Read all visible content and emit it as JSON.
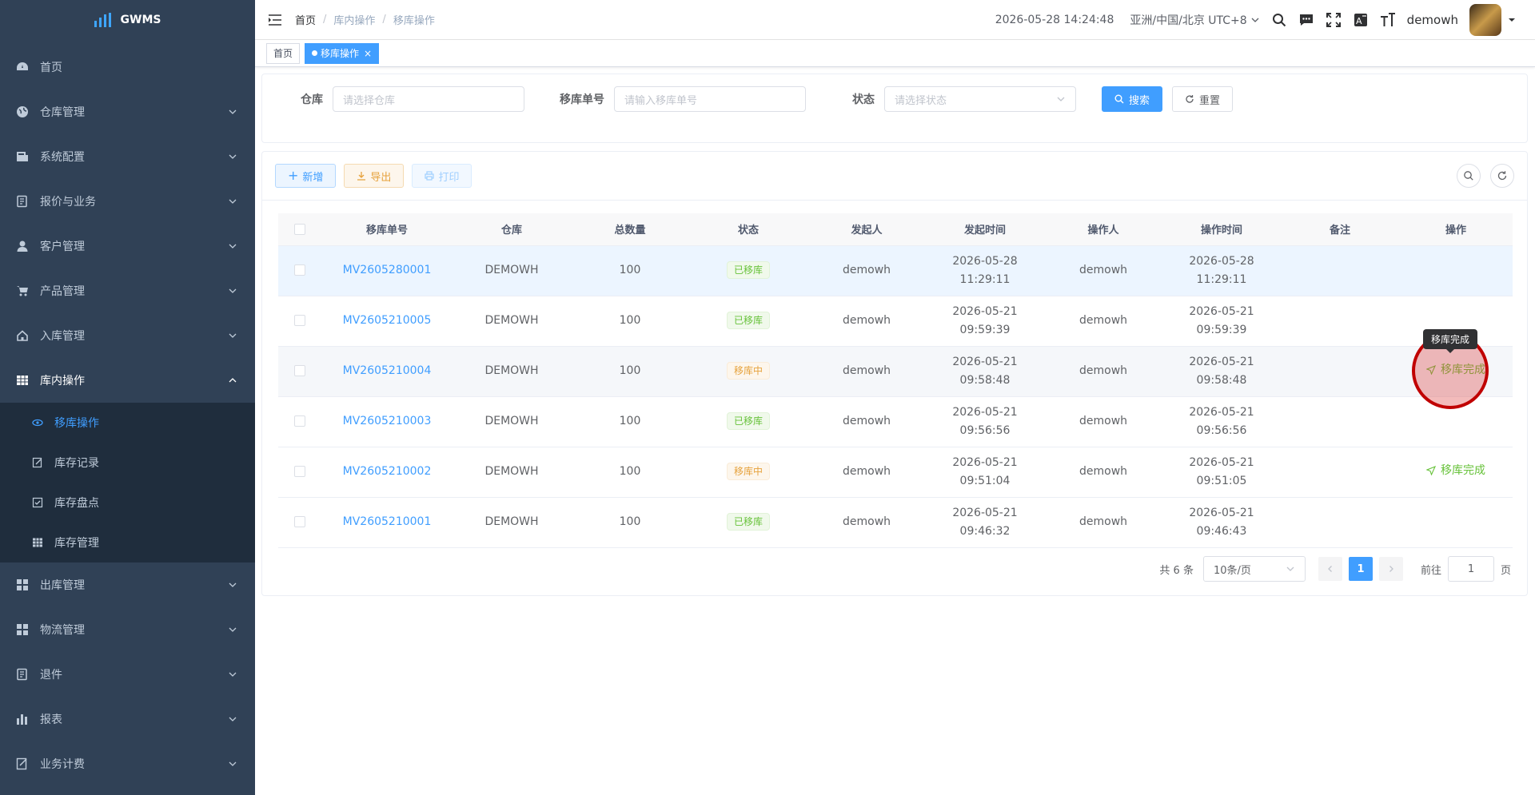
{
  "app": {
    "name": "GWMS"
  },
  "sidebar": {
    "items": [
      {
        "label": "首页",
        "icon": "dashboard-icon"
      },
      {
        "label": "仓库管理",
        "icon": "globe-icon"
      },
      {
        "label": "系统配置",
        "icon": "config-icon"
      },
      {
        "label": "报价与业务",
        "icon": "document-icon"
      },
      {
        "label": "客户管理",
        "icon": "user-icon"
      },
      {
        "label": "产品管理",
        "icon": "cart-icon"
      },
      {
        "label": "入库管理",
        "icon": "home-icon"
      },
      {
        "label": "库内操作",
        "icon": "table-icon"
      }
    ],
    "sub_items": [
      {
        "label": "移库操作",
        "icon": "eye-icon"
      },
      {
        "label": "库存记录",
        "icon": "edit-icon"
      },
      {
        "label": "库存盘点",
        "icon": "checkbox-icon"
      },
      {
        "label": "库存管理",
        "icon": "table-icon"
      }
    ],
    "items_after": [
      {
        "label": "出库管理",
        "icon": "grid-icon"
      },
      {
        "label": "物流管理",
        "icon": "grid-icon"
      },
      {
        "label": "退件",
        "icon": "document-icon"
      },
      {
        "label": "报表",
        "icon": "chart-icon"
      },
      {
        "label": "业务计费",
        "icon": "edit-icon"
      }
    ]
  },
  "header": {
    "breadcrumb": [
      "首页",
      "库内操作",
      "移库操作"
    ],
    "datetime": "2026-05-28 14:24:48",
    "timezone": "亚洲/中国/北京 UTC+8",
    "username": "demowh"
  },
  "tags": [
    {
      "label": "首页"
    },
    {
      "label": "移库操作"
    }
  ],
  "search": {
    "warehouse_label": "仓库",
    "warehouse_placeholder": "请选择仓库",
    "code_label": "移库单号",
    "code_placeholder": "请输入移库单号",
    "status_label": "状态",
    "status_placeholder": "请选择状态",
    "search_btn": "搜索",
    "reset_btn": "重置"
  },
  "toolbar": {
    "add": "新增",
    "export": "导出",
    "print": "打印"
  },
  "table": {
    "headers": [
      "移库单号",
      "仓库",
      "总数量",
      "状态",
      "发起人",
      "发起时间",
      "操作人",
      "操作时间",
      "备注",
      "操作"
    ],
    "rows": [
      {
        "code": "MV2605280001",
        "warehouse": "DEMOWH",
        "qty": "100",
        "status": "已移库",
        "initiator": "demowh",
        "init_date": "2026-05-28",
        "init_time": "11:29:11",
        "operator": "demowh",
        "op_date": "2026-05-28",
        "op_time": "11:29:11",
        "remark": "",
        "action": ""
      },
      {
        "code": "MV2605210005",
        "warehouse": "DEMOWH",
        "qty": "100",
        "status": "已移库",
        "initiator": "demowh",
        "init_date": "2026-05-21",
        "init_time": "09:59:39",
        "operator": "demowh",
        "op_date": "2026-05-21",
        "op_time": "09:59:39",
        "remark": "",
        "action": ""
      },
      {
        "code": "MV2605210004",
        "warehouse": "DEMOWH",
        "qty": "100",
        "status": "移库中",
        "initiator": "demowh",
        "init_date": "2026-05-21",
        "init_time": "09:58:48",
        "operator": "demowh",
        "op_date": "2026-05-21",
        "op_time": "09:58:48",
        "remark": "",
        "action": "移库完成"
      },
      {
        "code": "MV2605210003",
        "warehouse": "DEMOWH",
        "qty": "100",
        "status": "已移库",
        "initiator": "demowh",
        "init_date": "2026-05-21",
        "init_time": "09:56:56",
        "operator": "demowh",
        "op_date": "2026-05-21",
        "op_time": "09:56:56",
        "remark": "",
        "action": ""
      },
      {
        "code": "MV2605210002",
        "warehouse": "DEMOWH",
        "qty": "100",
        "status": "移库中",
        "initiator": "demowh",
        "init_date": "2026-05-21",
        "init_time": "09:51:04",
        "operator": "demowh",
        "op_date": "2026-05-21",
        "op_time": "09:51:05",
        "remark": "",
        "action": "移库完成"
      },
      {
        "code": "MV2605210001",
        "warehouse": "DEMOWH",
        "qty": "100",
        "status": "已移库",
        "initiator": "demowh",
        "init_date": "2026-05-21",
        "init_time": "09:46:32",
        "operator": "demowh",
        "op_date": "2026-05-21",
        "op_time": "09:46:43",
        "remark": "",
        "action": ""
      }
    ]
  },
  "tooltip": "移库完成",
  "pagination": {
    "total": "共 6 条",
    "page_size": "10条/页",
    "current": "1",
    "goto_label": "前往",
    "goto_value": "1",
    "page_suffix": "页"
  },
  "colors": {
    "primary": "#409eff",
    "sidebar_bg": "#304156",
    "success": "#67c23a",
    "warning": "#e6a23c"
  }
}
